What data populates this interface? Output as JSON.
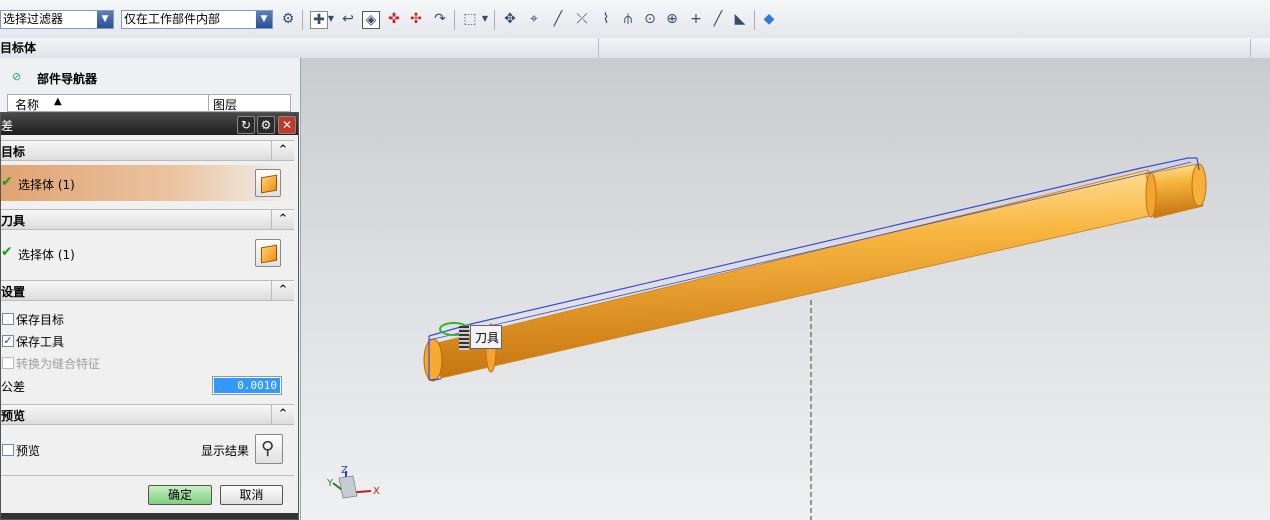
{
  "toolbar": {
    "filter_combo": "选择过滤器",
    "scope_combo": "仅在工作部件内部"
  },
  "selbar": {
    "label": "目标体"
  },
  "navigator": {
    "title": "部件导航器",
    "col_name": "名称",
    "col_layer": "图层"
  },
  "dialog": {
    "title": "差",
    "section_target": "目标",
    "target_select": "选择体 (1)",
    "section_tool": "刀具",
    "tool_select": "选择体 (1)",
    "section_settings": "设置",
    "keep_target": "保存目标",
    "keep_tool": "保存工具",
    "convert_sew": "转换为缝合特征",
    "tolerance_label": "公差",
    "tolerance_value": "0.0010",
    "section_preview": "预览",
    "preview_label": "预览",
    "show_result": "显示结果",
    "ok": "确定",
    "cancel": "取消"
  },
  "viewport": {
    "tooltip": "刀具",
    "axis_z": "Z",
    "axis_y": "Y",
    "axis_x": "X"
  },
  "colors": {
    "rod": "#f5a623",
    "wire": "#3c4bd6",
    "selection": "#e4b083"
  },
  "icons": [
    "refresh-icon",
    "gear-icon",
    "close-icon",
    "chevron-up-icon",
    "cube-icon",
    "magnifier-icon",
    "check-icon"
  ]
}
